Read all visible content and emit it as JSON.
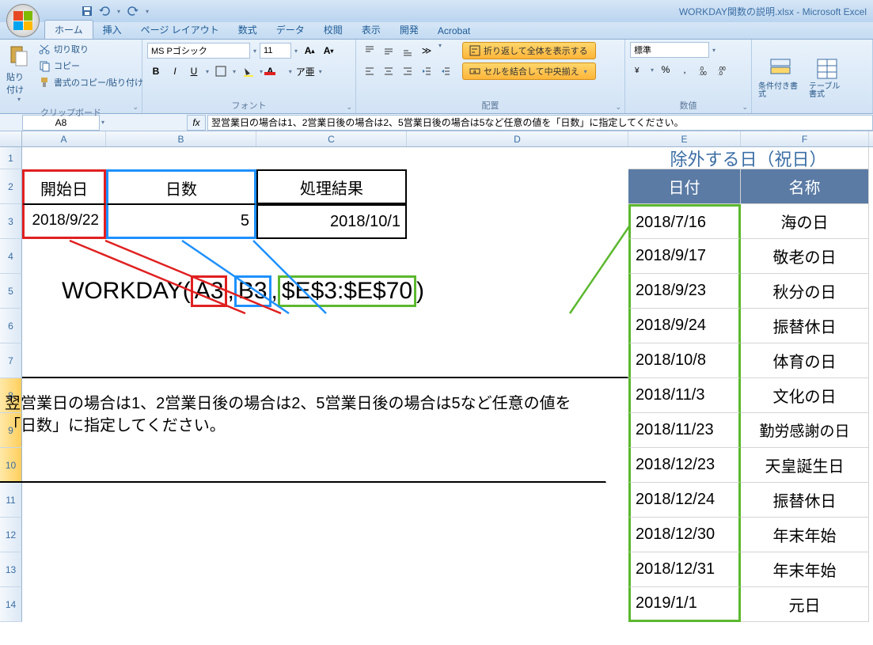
{
  "app": {
    "title": "WORKDAY関数の説明.xlsx - Microsoft Excel",
    "qat": {
      "save": "保存",
      "undo": "元に戻す",
      "redo": "やり直し"
    }
  },
  "tabs": [
    "ホーム",
    "挿入",
    "ページ レイアウト",
    "数式",
    "データ",
    "校閲",
    "表示",
    "開発",
    "Acrobat"
  ],
  "ribbon": {
    "clipboard": {
      "label": "クリップボード",
      "paste": "貼り付け",
      "cut": "切り取り",
      "copy": "コピー",
      "format_painter": "書式のコピー/貼り付け"
    },
    "font": {
      "label": "フォント",
      "family": "MS Pゴシック",
      "size": "11"
    },
    "alignment": {
      "label": "配置",
      "wrap": "折り返して全体を表示する",
      "merge": "セルを結合して中央揃え"
    },
    "number": {
      "label": "数値",
      "format": "標準"
    },
    "styles": {
      "conditional": "条件付き書式",
      "table": "テーブル書式"
    }
  },
  "namebox": "A8",
  "formula_bar": "翌営業日の場合は1、2営業日後の場合は2、5営業日後の場合は5など任意の値を「日数」に指定してください。",
  "columns": [
    "A",
    "B",
    "C",
    "D",
    "E",
    "F"
  ],
  "sheet": {
    "headers": {
      "start": "開始日",
      "days": "日数",
      "result": "処理結果"
    },
    "r3": {
      "start": "2018/9/22",
      "days": "5",
      "result": "2018/10/1"
    },
    "excl_title": "除外する日（祝日）",
    "excl_hdr": {
      "date": "日付",
      "name": "名称"
    },
    "holidays": [
      {
        "date": "2018/7/16",
        "name": "海の日"
      },
      {
        "date": "2018/9/17",
        "name": "敬老の日"
      },
      {
        "date": "2018/9/23",
        "name": "秋分の日"
      },
      {
        "date": "2018/9/24",
        "name": "振替休日"
      },
      {
        "date": "2018/10/8",
        "name": "体育の日"
      },
      {
        "date": "2018/11/3",
        "name": "文化の日"
      },
      {
        "date": "2018/11/23",
        "name": "勤労感謝の日"
      },
      {
        "date": "2018/12/23",
        "name": "天皇誕生日"
      },
      {
        "date": "2018/12/24",
        "name": "振替休日"
      },
      {
        "date": "2018/12/30",
        "name": "年末年始"
      },
      {
        "date": "2018/12/31",
        "name": "年末年始"
      },
      {
        "date": "2019/1/1",
        "name": "元日"
      }
    ],
    "formula": {
      "fn": "WORKDAY(",
      "a1": "A3",
      "a2": "B3",
      "a3": "$E$3:$E$70",
      "close": ")"
    },
    "note": "翌営業日の場合は1、2営業日後の場合は2、5営業日後の場合は5など任意の値を「日数」に指定してください。"
  }
}
